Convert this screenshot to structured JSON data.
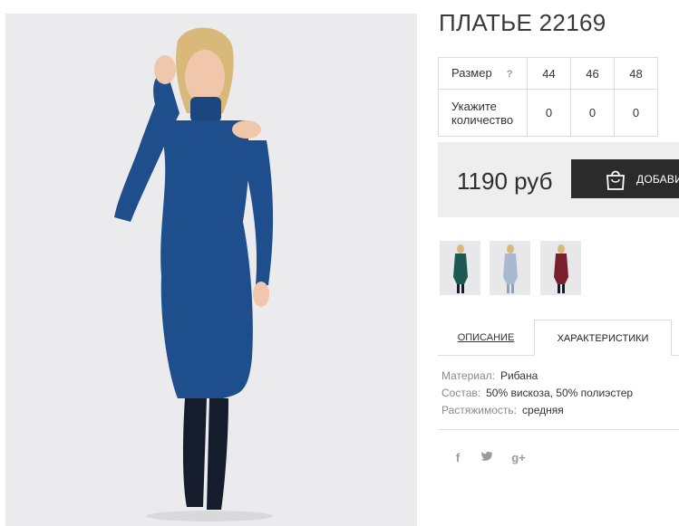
{
  "product": {
    "title": "ПЛАТЬЕ 22169"
  },
  "size_table": {
    "size_label": "Размер",
    "help_icon": "?",
    "sizes": [
      "44",
      "46",
      "48"
    ],
    "quantity_label_1": "Укажите",
    "quantity_label_2": "количество",
    "quantities": [
      "0",
      "0",
      "0"
    ]
  },
  "purchase": {
    "price": "1190 руб",
    "button_label": "ДОБАВИ",
    "button_icon": "shopping-bag-icon"
  },
  "colors": {
    "accent": "#2b2b2b",
    "dress_main": "#1f4e8c",
    "thumb_colors": [
      "#1b5a52",
      "#a9b9cf",
      "#7a1f2e"
    ]
  },
  "tabs": [
    {
      "label": "ОПИСАНИЕ",
      "active": false
    },
    {
      "label": "ХАРАКТЕРИСТИКИ",
      "active": true
    }
  ],
  "specs": [
    {
      "key": "Материал:",
      "value": "Рибана"
    },
    {
      "key": "Состав:",
      "value": "50% вискоза, 50% полиэстер"
    },
    {
      "key": "Растяжимость:",
      "value": "средняя"
    }
  ],
  "social": [
    {
      "glyph": "f",
      "icon": "facebook-icon"
    },
    {
      "glyph": "🐦",
      "icon": "twitter-icon"
    },
    {
      "glyph": "g+",
      "icon": "google-plus-icon"
    }
  ]
}
